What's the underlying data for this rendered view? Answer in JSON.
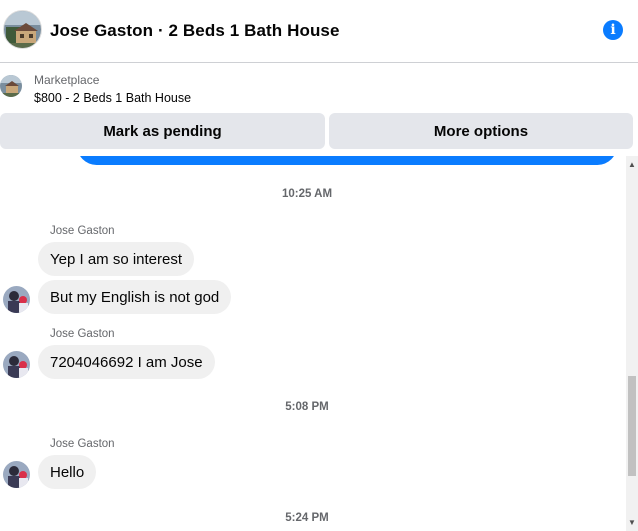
{
  "header": {
    "title": "Jose Gaston · 2 Beds 1 Bath House",
    "info_icon": "i"
  },
  "marketplace": {
    "label": "Marketplace",
    "listing": "$800 - 2 Beds 1 Bath House"
  },
  "actions": {
    "pending": "Mark as pending",
    "more": "More options"
  },
  "thread": {
    "groups": [
      {
        "timestamp": "10:25 AM",
        "sender": "Jose Gaston",
        "messages": [
          "Yep I am so interest",
          "But my English is not god"
        ]
      },
      {
        "timestamp": "",
        "sender": "Jose Gaston",
        "messages": [
          "7204046692 I am Jose"
        ]
      },
      {
        "timestamp": "5:08 PM",
        "sender": "Jose Gaston",
        "messages": [
          "Hello"
        ]
      },
      {
        "timestamp": "5:24 PM",
        "sender": "",
        "messages": []
      }
    ]
  },
  "colors": {
    "accent": "#0a7cff",
    "bubble_incoming": "#f0f0f0",
    "button_bg": "#e4e6eb",
    "muted_text": "#65676b"
  },
  "icons": {
    "info": "info-icon",
    "scroll_up": "▲",
    "scroll_down": "▼"
  }
}
